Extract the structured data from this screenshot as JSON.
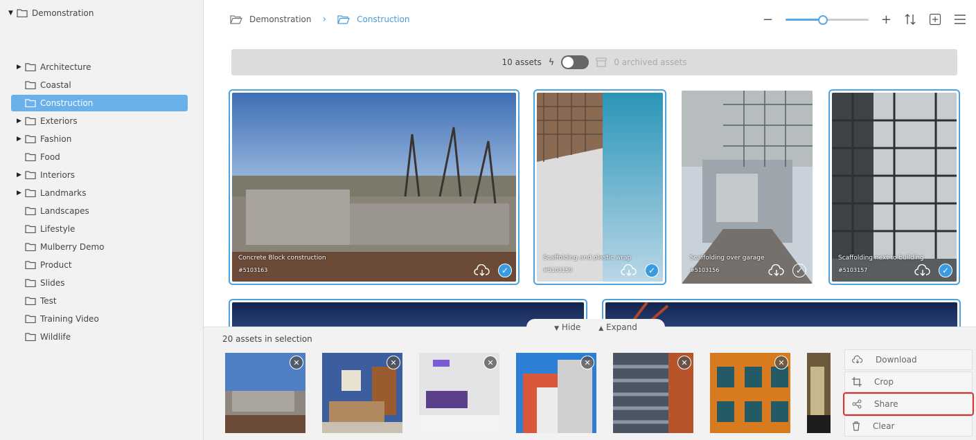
{
  "sidebar": {
    "root": "Demonstration",
    "items": [
      {
        "label": "Architecture",
        "expandable": true
      },
      {
        "label": "Coastal",
        "expandable": false
      },
      {
        "label": "Construction",
        "expandable": false,
        "selected": true
      },
      {
        "label": "Exteriors",
        "expandable": true
      },
      {
        "label": "Fashion",
        "expandable": true
      },
      {
        "label": "Food",
        "expandable": false
      },
      {
        "label": "Interiors",
        "expandable": true
      },
      {
        "label": "Landmarks",
        "expandable": true
      },
      {
        "label": "Landscapes",
        "expandable": false
      },
      {
        "label": "Lifestyle",
        "expandable": false
      },
      {
        "label": "Mulberry Demo",
        "expandable": false
      },
      {
        "label": "Product",
        "expandable": false
      },
      {
        "label": "Slides",
        "expandable": false
      },
      {
        "label": "Test",
        "expandable": false
      },
      {
        "label": "Training Video",
        "expandable": false
      },
      {
        "label": "Wildlife",
        "expandable": false
      }
    ]
  },
  "breadcrumb": {
    "parent": "Demonstration",
    "current": "Construction"
  },
  "toolbar": {
    "zoom_level": 0.45
  },
  "assetbar": {
    "assets": "10 assets",
    "archived": "0 archived assets"
  },
  "cards": [
    {
      "title": "Concrete Block construction",
      "id": "#5103163",
      "selected": true
    },
    {
      "title": "Scaffolding and plastic wrap",
      "id": "#5103159",
      "selected": true
    },
    {
      "title": "Scaffolding over garage",
      "id": "#5103156",
      "selected": false
    },
    {
      "title": "Scaffolding next to building",
      "id": "#5103157",
      "selected": true
    }
  ],
  "tray": {
    "hide_label": "Hide",
    "expand_label": "Expand",
    "selection_count": "20 assets in selection"
  },
  "actions": {
    "download": "Download",
    "crop": "Crop",
    "share": "Share",
    "clear": "Clear"
  },
  "colors": {
    "accent": "#4aa3e0",
    "selected_folder": "#6ab0ea",
    "highlight": "#e03030"
  }
}
